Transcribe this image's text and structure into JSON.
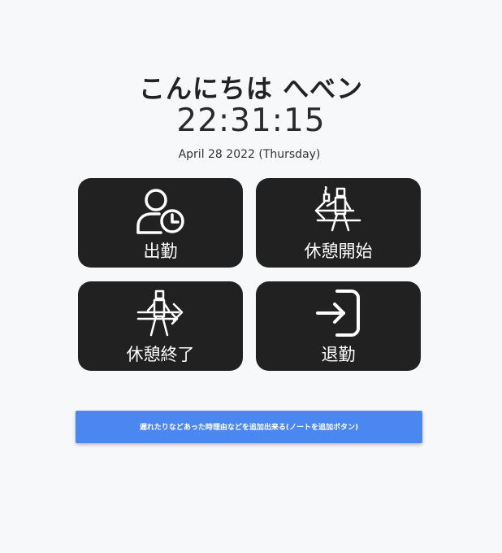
{
  "header": {
    "greeting": "こんにちは へべン",
    "time": "22:31:15",
    "date": "April 28 2022 (Thursday)"
  },
  "actions": [
    {
      "label": "出勤",
      "icon": "user-clock-icon"
    },
    {
      "label": "休憩開始",
      "icon": "break-start-icon"
    },
    {
      "label": "休憩終了",
      "icon": "break-end-icon"
    },
    {
      "label": "退勤",
      "icon": "sign-in-icon"
    }
  ],
  "note_button": {
    "label": "遅れたりなどあった時理由などを追加出来る(ノートを追加ボタン)"
  },
  "colors": {
    "background": "#f7f8fa",
    "tile": "#212121",
    "button": "#4a87f0"
  }
}
